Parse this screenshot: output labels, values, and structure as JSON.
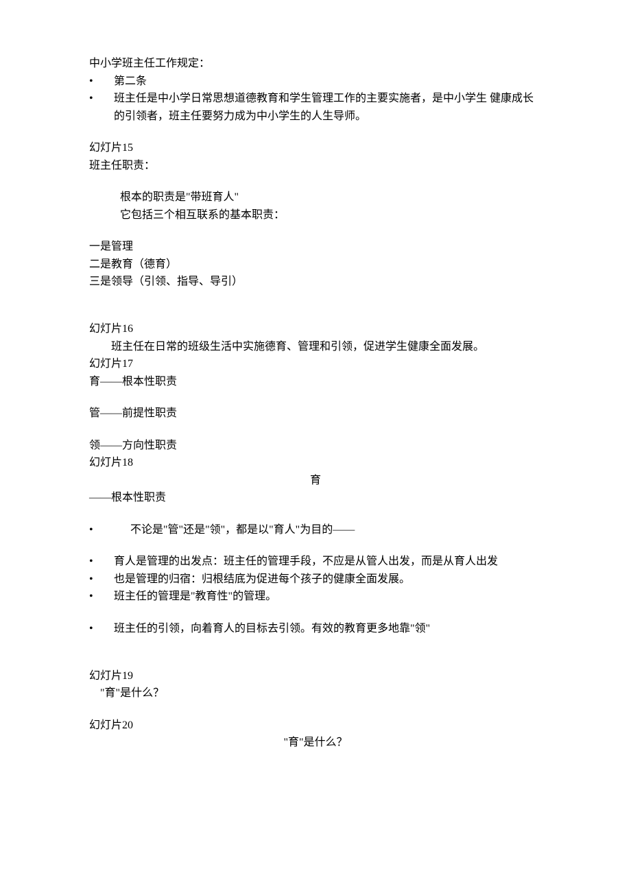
{
  "header": {
    "title": "中小学班主任工作规定：",
    "bullets": [
      "第二条",
      "班主任是中小学日常思想道德教育和学生管理工作的主要实施者，是中小学生 健康成长的引领者，班主任要努力成为中小学生的人生导师。"
    ]
  },
  "slide15": {
    "label": "幻灯片15",
    "title": "班主任职责：",
    "sub1": "根本的职责是\"带班育人\"",
    "sub2": "它包括三个相互联系的基本职责：",
    "items": [
      "一是管理",
      "二是教育（德育）",
      "三是领导（引领、指导、导引）"
    ]
  },
  "slide16": {
    "label": "幻灯片16",
    "text": "班主任在日常的班级生活中实施德育、管理和引领，促进学生健康全面发展。"
  },
  "slide17": {
    "label": "幻灯片17",
    "items": [
      "育——根本性职责",
      "管——前提性职责",
      "领——方向性职责"
    ]
  },
  "slide18": {
    "label": "幻灯片18",
    "centerTitle": "育",
    "sub": "——根本性职责",
    "bullet1": "不论是\"管\"还是\"领\"，都是以\"育人\"为目的——",
    "bullets2": [
      "育人是管理的出发点：班主任的管理手段，不应是从管人出发，而是从育人出发",
      "也是管理的归宿：归根结底为促进每个孩子的健康全面发展。",
      "班主任的管理是\"教育性\"的管理。"
    ],
    "bullet3": "班主任的引领，向着育人的目标去引领。有效的教育更多地靠\"领\""
  },
  "slide19": {
    "label": "幻灯片19",
    "text": "\"育\"是什么？"
  },
  "slide20": {
    "label": "幻灯片20",
    "centerText": "\"育\"是什么？"
  }
}
